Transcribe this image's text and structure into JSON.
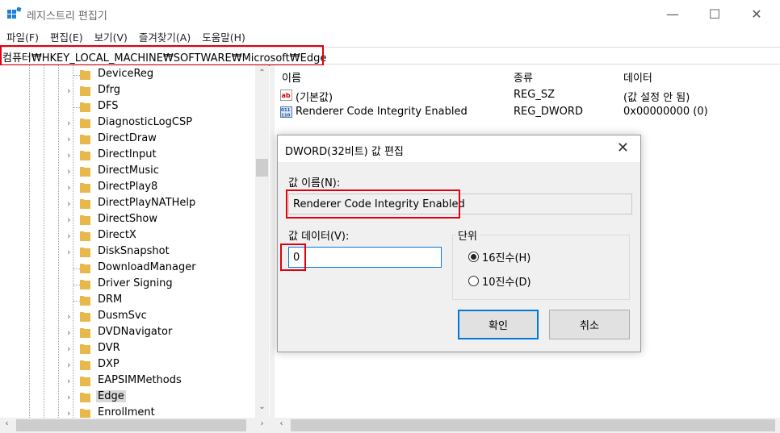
{
  "window": {
    "title": "레지스트리 편집기",
    "minimize_glyph": "—",
    "maximize_glyph": "☐",
    "close_glyph": "✕"
  },
  "menu": [
    "파일(F)",
    "편집(E)",
    "보기(V)",
    "즐겨찾기(A)",
    "도움말(H)"
  ],
  "address": "컴퓨터₩HKEY_LOCAL_MACHINE₩SOFTWARE₩Microsoft₩Edge",
  "tree": {
    "items": [
      {
        "label": "DeviceReg",
        "expandable": false,
        "selected": false
      },
      {
        "label": "Dfrg",
        "expandable": true,
        "selected": false
      },
      {
        "label": "DFS",
        "expandable": false,
        "selected": false
      },
      {
        "label": "DiagnosticLogCSP",
        "expandable": true,
        "selected": false
      },
      {
        "label": "DirectDraw",
        "expandable": true,
        "selected": false
      },
      {
        "label": "DirectInput",
        "expandable": true,
        "selected": false
      },
      {
        "label": "DirectMusic",
        "expandable": true,
        "selected": false
      },
      {
        "label": "DirectPlay8",
        "expandable": true,
        "selected": false
      },
      {
        "label": "DirectPlayNATHelp",
        "expandable": true,
        "selected": false
      },
      {
        "label": "DirectShow",
        "expandable": true,
        "selected": false
      },
      {
        "label": "DirectX",
        "expandable": true,
        "selected": false
      },
      {
        "label": "DiskSnapshot",
        "expandable": true,
        "selected": false
      },
      {
        "label": "DownloadManager",
        "expandable": false,
        "selected": false
      },
      {
        "label": "Driver Signing",
        "expandable": false,
        "selected": false
      },
      {
        "label": "DRM",
        "expandable": false,
        "selected": false
      },
      {
        "label": "DusmSvc",
        "expandable": true,
        "selected": false
      },
      {
        "label": "DVDNavigator",
        "expandable": true,
        "selected": false
      },
      {
        "label": "DVR",
        "expandable": true,
        "selected": false
      },
      {
        "label": "DXP",
        "expandable": true,
        "selected": false
      },
      {
        "label": "EAPSIMMethods",
        "expandable": true,
        "selected": false
      },
      {
        "label": "Edge",
        "expandable": true,
        "selected": true
      },
      {
        "label": "Enrollment",
        "expandable": true,
        "selected": false
      }
    ]
  },
  "list": {
    "columns": [
      "이름",
      "종류",
      "데이터"
    ],
    "rows": [
      {
        "icon": "string-value-icon",
        "name": "(기본값)",
        "type": "REG_SZ",
        "data": "(값 설정 안 됨)"
      },
      {
        "icon": "dword-value-icon",
        "name": "Renderer Code Integrity Enabled",
        "type": "REG_DWORD",
        "data": "0x00000000 (0)"
      }
    ]
  },
  "dialog": {
    "title": "DWORD(32비트) 값 편집",
    "close_glyph": "✕",
    "name_label": "값 이름(N):",
    "name_value": "Renderer Code Integrity Enabled",
    "data_label": "값 데이터(V):",
    "data_value": "0",
    "base_label": "단위",
    "hex_label": "16진수(H)",
    "dec_label": "10진수(D)",
    "selected_base": "hex",
    "ok_label": "확인",
    "cancel_label": "취소"
  },
  "colors": {
    "highlight": "#e0000f",
    "accent": "#0078d7",
    "folder": "#e8b84a"
  }
}
